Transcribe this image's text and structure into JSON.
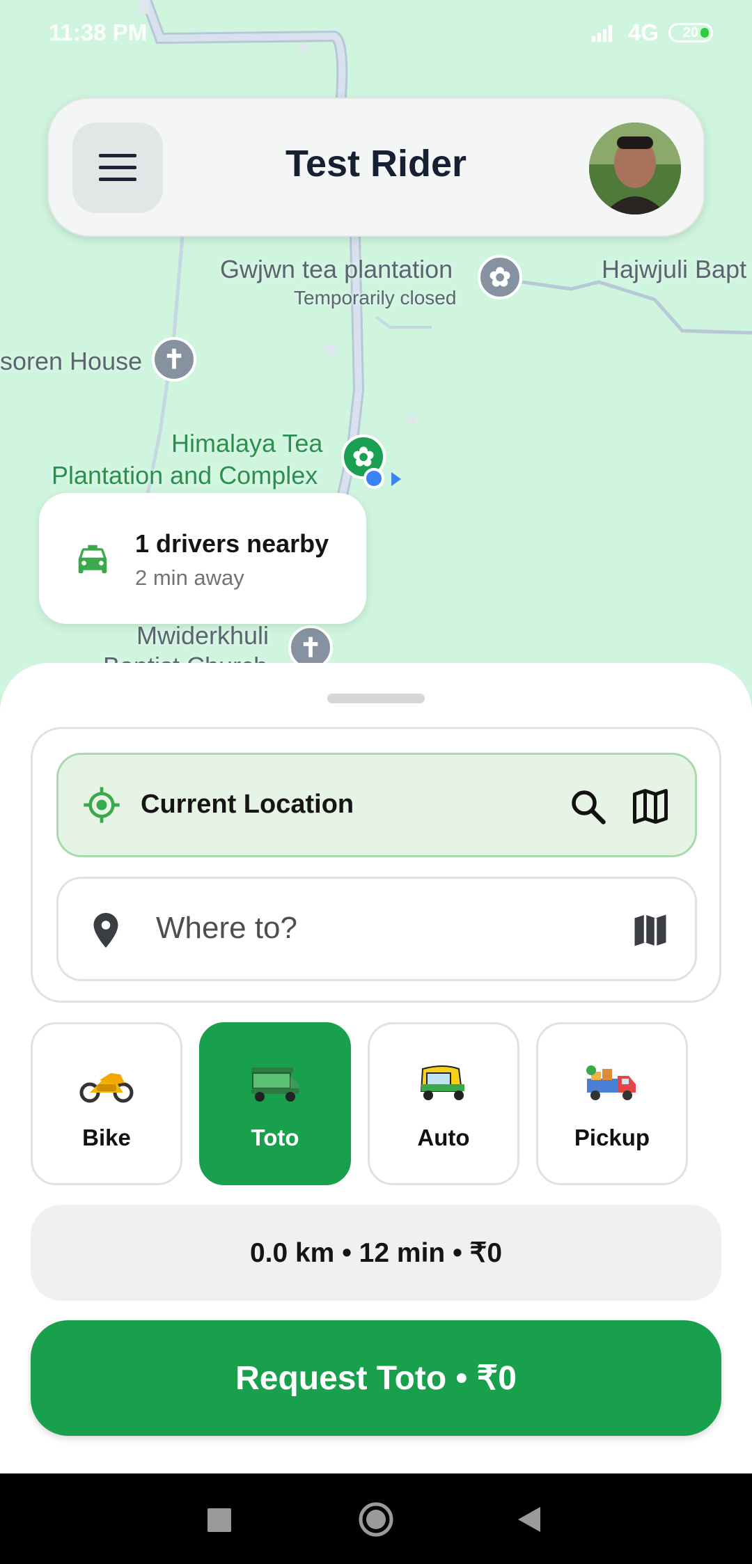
{
  "status_bar": {
    "time": "11:38 PM",
    "network": "4G",
    "battery": "20"
  },
  "header": {
    "title": "Test Rider",
    "menu_icon": "hamburger-menu-icon"
  },
  "map": {
    "labels": {
      "gwjwn": "Gwjwn tea plantation",
      "gwjwn_status": "Temporarily closed",
      "hajwjuli": "Hajwjuli Bapt",
      "soren": "soren House",
      "himalaya_1": "Himalaya Tea",
      "himalaya_2": "Plantation and Complex",
      "mwiderkhuli": "Mwiderkhuli",
      "mwiderkhuli_2": "Baptist Church"
    }
  },
  "nearby": {
    "title": "1 drivers nearby",
    "subtitle": "2 min away"
  },
  "pickup": {
    "label": "Current Location"
  },
  "destination": {
    "placeholder": "Where to?"
  },
  "vehicles": [
    {
      "label": "Bike",
      "selected": false
    },
    {
      "label": "Toto",
      "selected": true
    },
    {
      "label": "Auto",
      "selected": false
    },
    {
      "label": "Pickup",
      "selected": false
    }
  ],
  "trip_summary": "0.0 km • 12 min • ₹0",
  "request_button": "Request Toto • ₹0",
  "colors": {
    "primary": "#19a04c",
    "map_bg": "#cff5de",
    "text_dark": "#152032"
  }
}
